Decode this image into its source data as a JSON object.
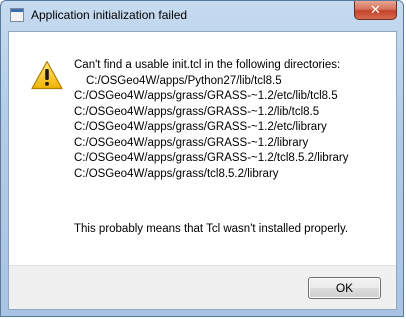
{
  "window": {
    "title": "Application initialization failed",
    "close_label": "✕"
  },
  "dialog": {
    "icon": "warning-icon",
    "message_lines": [
      "Can't find a usable init.tcl in the following directories:",
      "C:/OSGeo4W/apps/Python27/lib/tcl8.5",
      "C:/OSGeo4W/apps/grass/GRASS-~1.2/etc/lib/tcl8.5",
      "C:/OSGeo4W/apps/grass/GRASS-~1.2/lib/tcl8.5",
      "C:/OSGeo4W/apps/grass/GRASS-~1.2/etc/library",
      "C:/OSGeo4W/apps/grass/GRASS-~1.2/library",
      "C:/OSGeo4W/apps/grass/GRASS-~1.2/tcl8.5.2/library",
      "C:/OSGeo4W/apps/grass/tcl8.5.2/library"
    ],
    "footer_message": "This probably means that Tcl wasn't installed properly.",
    "ok_label": "OK"
  },
  "colors": {
    "warning_fill": "#f5c518",
    "warning_stroke": "#b08000",
    "close_button": "#c2442a"
  }
}
